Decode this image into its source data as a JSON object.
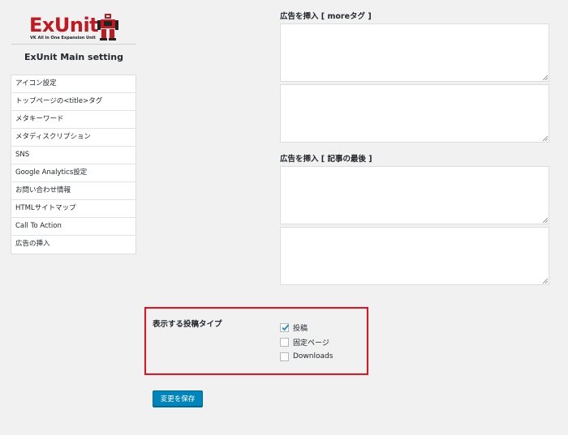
{
  "logo": {
    "word": "ExUnit",
    "tagline": "VK All in One Expansion Unit"
  },
  "sidebar": {
    "title": "ExUnit Main setting",
    "items": [
      {
        "label": "アイコン設定"
      },
      {
        "label": "トップページの<title>タグ"
      },
      {
        "label": "メタキーワード"
      },
      {
        "label": "メタディスクリプション"
      },
      {
        "label": "SNS"
      },
      {
        "label": "Google Analytics設定"
      },
      {
        "label": "お問い合わせ情報"
      },
      {
        "label": "HTMLサイトマップ"
      },
      {
        "label": "Call To Action"
      },
      {
        "label": "広告の挿入"
      }
    ]
  },
  "ads": {
    "more_label": "広告を挿入 [ moreタグ ]",
    "end_label": "広告を挿入 [ 記事の最後 ]"
  },
  "post_types": {
    "label": "表示する投稿タイプ",
    "options": [
      {
        "label": "投稿",
        "checked": true
      },
      {
        "label": "固定ページ",
        "checked": false
      },
      {
        "label": "Downloads",
        "checked": false
      }
    ]
  },
  "save_button": "変更を保存",
  "colors": {
    "brand_red": "#c2181f",
    "highlight_red": "#e8101f",
    "primary_button": "#0085ba"
  }
}
